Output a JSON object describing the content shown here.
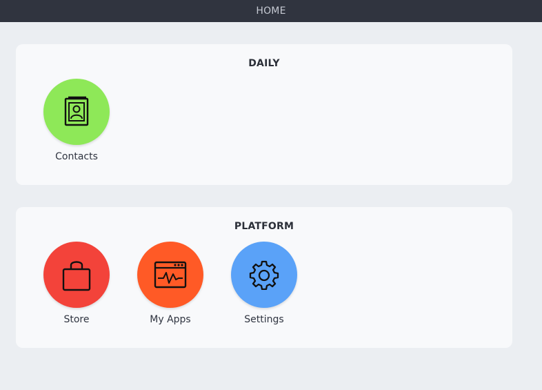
{
  "header": {
    "title": "HOME"
  },
  "sections": [
    {
      "title": "DAILY",
      "apps": [
        {
          "label": "Contacts",
          "icon": "contacts-book-icon",
          "color": "#8ee858"
        }
      ]
    },
    {
      "title": "PLATFORM",
      "apps": [
        {
          "label": "Store",
          "icon": "shopping-bag-icon",
          "color": "#f3433a"
        },
        {
          "label": "My Apps",
          "icon": "browser-activity-icon",
          "color": "#ff5a26"
        },
        {
          "label": "Settings",
          "icon": "gear-icon",
          "color": "#5aa2f8"
        }
      ]
    }
  ]
}
